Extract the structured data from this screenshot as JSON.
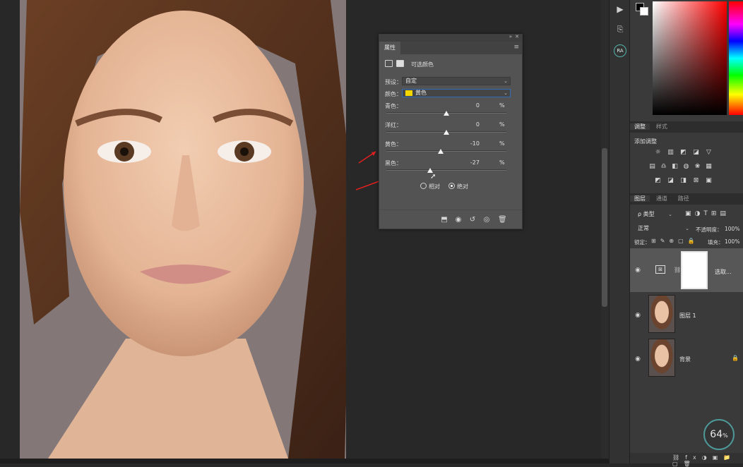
{
  "properties_panel": {
    "tab_label": "属性",
    "adjustment_name": "可选颜色",
    "preset_label": "预设：",
    "preset_value": "自定",
    "colors_label": "颜色：",
    "colors_value": "黄色",
    "colors_swatch": "#f5d700",
    "sliders": [
      {
        "label": "青色：",
        "value": "0",
        "unit": "%",
        "level": 0
      },
      {
        "label": "洋红：",
        "value": "0",
        "unit": "%",
        "level": 0
      },
      {
        "label": "黄色：",
        "value": "-10",
        "unit": "%",
        "level": -10
      },
      {
        "label": "黑色：",
        "value": "-27",
        "unit": "%",
        "level": -27
      }
    ],
    "method_relative": "相对",
    "method_absolute": "绝对",
    "method_selected": "absolute"
  },
  "annotations": {
    "arrow_color": "#e02020"
  },
  "right_panel": {
    "adjust_tab": "调整",
    "styles_tab": "样式",
    "add_adjustment": "添加调整",
    "layers_tab": "图层",
    "channels_tab": "通道",
    "paths_tab": "路径",
    "filter_type": "ρ 类型",
    "blend_mode": "正常",
    "opacity_label": "不透明度：",
    "opacity_value": "100%",
    "lock_label": "锁定：",
    "fill_label": "填充：",
    "fill_value": "100%",
    "layers": [
      {
        "name": "选取...",
        "kind": "adjustment"
      },
      {
        "name": "图层 1",
        "kind": "image"
      },
      {
        "name": "背景",
        "kind": "image",
        "locked": true
      }
    ]
  },
  "toolbar_strip": {
    "play_icon": "▶",
    "ra_label": "RA"
  },
  "zoom_badge": {
    "value": "64",
    "unit": "%"
  }
}
